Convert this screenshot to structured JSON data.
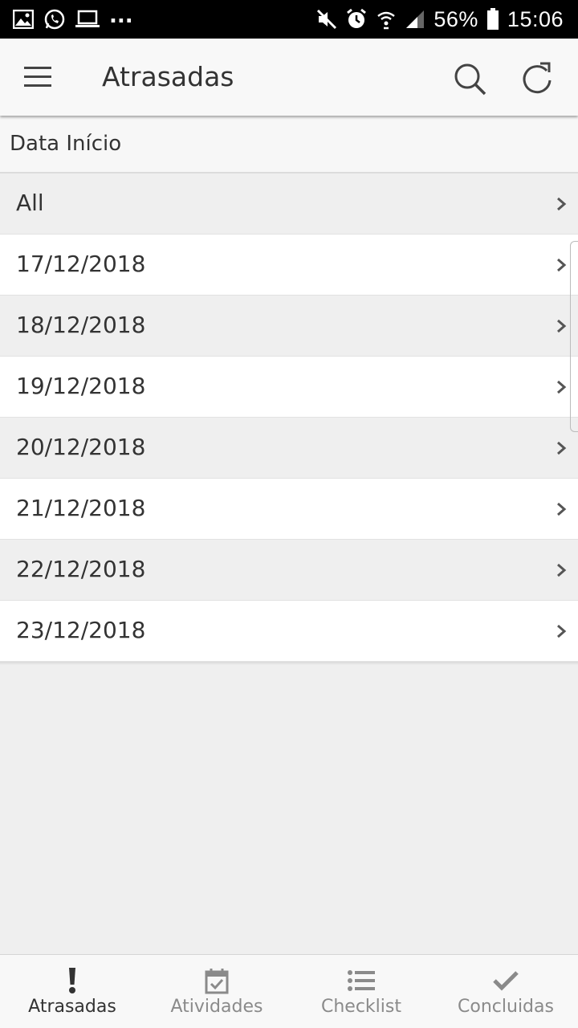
{
  "status_bar": {
    "dots": "...",
    "battery_percent": "56%",
    "time": "15:06"
  },
  "app_bar": {
    "title": "Atrasadas",
    "icons": [
      "menu-icon",
      "search-icon",
      "refresh-icon"
    ]
  },
  "section": {
    "header": "Data Início"
  },
  "list": {
    "items": [
      {
        "label": "All"
      },
      {
        "label": "17/12/2018"
      },
      {
        "label": "18/12/2018"
      },
      {
        "label": "19/12/2018"
      },
      {
        "label": "20/12/2018"
      },
      {
        "label": "21/12/2018"
      },
      {
        "label": "22/12/2018"
      },
      {
        "label": "23/12/2018"
      }
    ]
  },
  "bottom_nav": {
    "tabs": [
      {
        "label": "Atrasadas",
        "icon": "exclamation-icon",
        "active": true
      },
      {
        "label": "Atividades",
        "icon": "calendar-check-icon",
        "active": false
      },
      {
        "label": "Checklist",
        "icon": "list-icon",
        "active": false
      },
      {
        "label": "Concluidas",
        "icon": "checkmark-icon",
        "active": false
      }
    ]
  },
  "colors": {
    "appbar_bg": "#f8f8f8",
    "page_bg": "#efefef",
    "active_tab": "#333333",
    "inactive_tab": "#8a8a8a"
  }
}
